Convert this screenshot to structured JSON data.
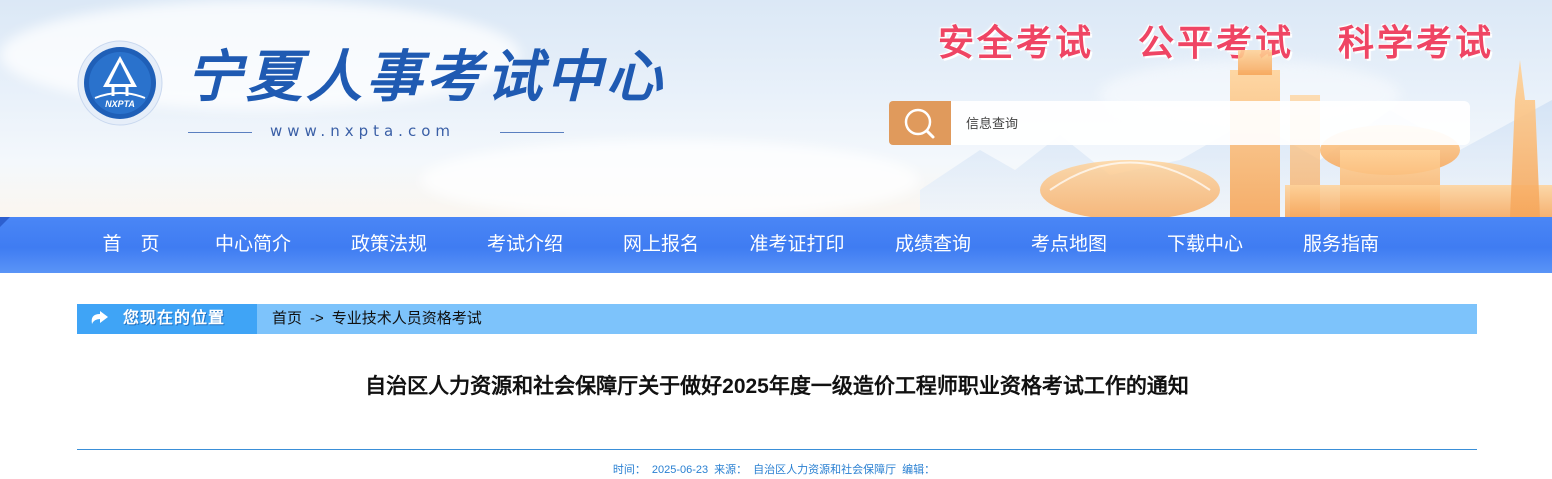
{
  "header": {
    "site_name": "宁夏人事考试中心",
    "site_url": "www.nxpta.com",
    "logo_text": "NXPTA",
    "slogans": [
      "安全考试",
      "公平考试",
      "科学考试"
    ],
    "search": {
      "placeholder": "信息查询",
      "icon": "search-icon"
    }
  },
  "nav": {
    "items": [
      "首　页",
      "中心简介",
      "政策法规",
      "考试介绍",
      "网上报名",
      "准考证打印",
      "成绩查询",
      "考点地图",
      "下载中心",
      "服务指南"
    ]
  },
  "breadcrumb": {
    "label": "您现在的位置",
    "items": [
      "首页",
      "专业技术人员资格考试"
    ],
    "separator": "->"
  },
  "article": {
    "title": "自治区人力资源和社会保障厅关于做好2025年度一级造价工程师职业资格考试工作的通知",
    "meta": {
      "time_label": "时间：",
      "time": "2025-06-23",
      "source_label": "来源：",
      "source": "自治区人力资源和社会保障厅",
      "editor_label": "编辑："
    }
  },
  "colors": {
    "nav_blue": "#4a86f6",
    "slogan_red": "#ef4564",
    "search_orange": "#e09a5c",
    "breadcrumb_bar": "#7dc3fb",
    "meta_blue": "#2a80d2"
  }
}
